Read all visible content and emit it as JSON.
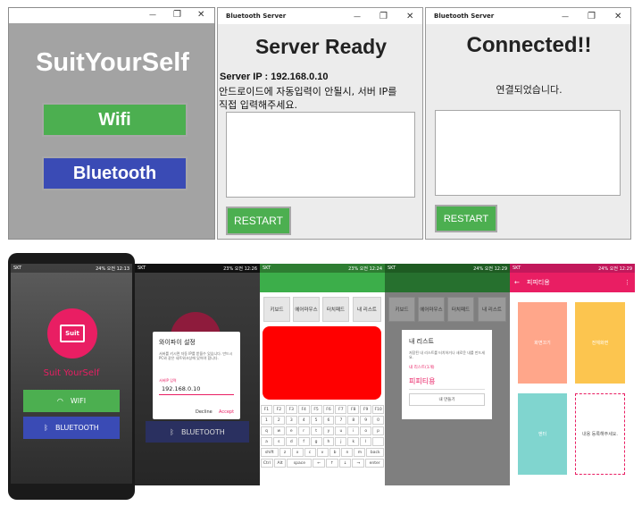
{
  "win1": {
    "title": "SuitYourSelf",
    "wifi": "Wifi",
    "bluetooth": "Bluetooth"
  },
  "win2": {
    "titlebar": "Bluetooth Server",
    "heading": "Server Ready",
    "ip_label": "Server IP : 192.168.0.10",
    "desc1": "안드로이드에 자동입력이 안될시, 서버 IP를",
    "desc2": "직접 입력해주세요.",
    "restart": "RESTART"
  },
  "win3": {
    "titlebar": "Bluetooth Server",
    "heading": "Connected!!",
    "msg": "연결되었습니다.",
    "restart": "RESTART"
  },
  "window_controls": {
    "minimize": "—",
    "maximize": "❐",
    "close": "✕"
  },
  "status": {
    "carrier": "SKT",
    "p1": "24% 오전 12:13",
    "p2": "23% 오전 12:26",
    "p3": "23% 오전 12:24",
    "p4": "24% 오전 12:29",
    "p5": "24% 오전 12:29"
  },
  "p1": {
    "logo": "Suit",
    "app_name": "Suit YourSelf",
    "wifi": "WIFI",
    "bluetooth": "BLUETOOTH"
  },
  "p2": {
    "dialog_title": "와이파이 설정",
    "dialog_body": "서버를 키시면 자동 IP를 받을수 있습니다. 만드시 PC와 같은 네트워크상에 있어야 합니다.",
    "ip_label": "서버IP 입력",
    "ip_value": "192.168.0.10",
    "decline": "Decline",
    "accept": "Accept",
    "bluetooth": "BLUETOOTH"
  },
  "p3": {
    "tabs": [
      "키보드",
      "에어마우스",
      "터치패드",
      "내 리스트"
    ],
    "keys": [
      [
        "F1",
        "F2",
        "F3",
        "F4",
        "F5",
        "F6",
        "F7",
        "F8",
        "F9",
        "F10"
      ],
      [
        "1",
        "2",
        "3",
        "4",
        "5",
        "6",
        "7",
        "8",
        "9",
        "0"
      ],
      [
        "q",
        "w",
        "e",
        "r",
        "t",
        "y",
        "u",
        "i",
        "o",
        "p"
      ],
      [
        "a",
        "s",
        "d",
        "f",
        "g",
        "h",
        "j",
        "k",
        "l",
        ""
      ],
      [
        "shift",
        "z",
        "x",
        "c",
        "v",
        "b",
        "n",
        "m",
        "back"
      ],
      [
        "Ctrl",
        "Alt",
        "space",
        "←",
        "↑",
        "↓",
        "→",
        "enter"
      ]
    ]
  },
  "p4": {
    "tabs": [
      "키보드",
      "에어마우스",
      "터치패드",
      "내 리스트"
    ],
    "dialog_title": "내 리스트",
    "dialog_body": "저장된 내 리스트를 터치하거나 새로운 내를 만드세요.",
    "count": "내 리스트(1개)",
    "item": "피피티용",
    "make": "내 만들기"
  },
  "p5": {
    "title": "피피티용",
    "tiles": [
      "화면끄기",
      "전체화면",
      "엔터",
      "내용 등록해주세요."
    ]
  },
  "colors": {
    "green": "#4caf50",
    "blue": "#3a4bb5",
    "pink": "#e91e63",
    "red": "#ff0000"
  }
}
